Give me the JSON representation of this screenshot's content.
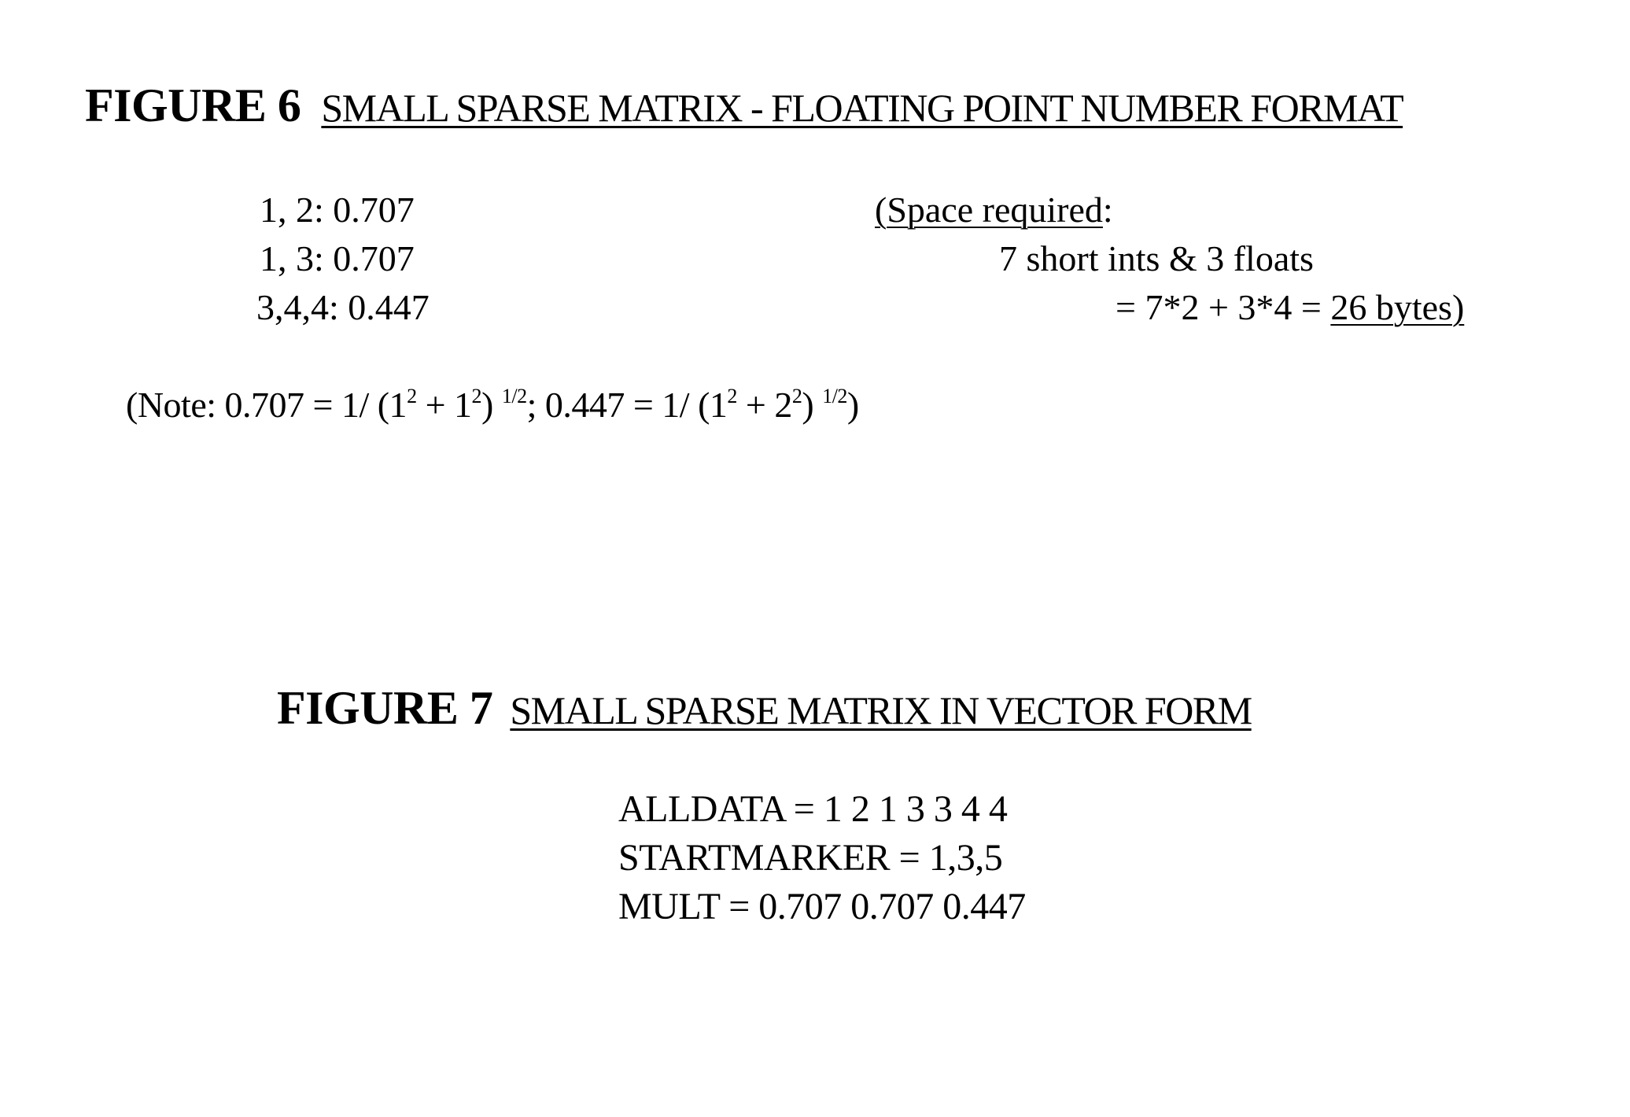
{
  "figure6": {
    "label": "FIGURE 6",
    "title": "SMALL SPARSE MATRIX - FLOATING POINT NUMBER FORMAT",
    "entries": [
      "1, 2: 0.707",
      "1, 3: 0.707",
      "3,4,4: 0.447"
    ],
    "space": {
      "open_paren": "(",
      "heading": "Space required",
      "colon": ":",
      "line2": "7 short ints & 3 floats",
      "line3_prefix": "= 7*2 + 3*4 = ",
      "total": "26 bytes",
      "close_paren": ")"
    },
    "note": {
      "prefix": "(Note:  0.707 = 1/ (1",
      "exp_a1": "2",
      "mid_a": " + 1",
      "exp_a2": "2",
      "close_a": ") ",
      "pow_a": "1/2",
      "sep": ";  0.447 = 1/ (1",
      "exp_b1": "2",
      "mid_b": " + 2",
      "exp_b2": "2",
      "close_b": ") ",
      "pow_b": "1/2",
      "suffix": ")"
    }
  },
  "figure7": {
    "label": "FIGURE 7",
    "title": "SMALL SPARSE MATRIX IN VECTOR FORM",
    "lines": [
      "ALLDATA = 1 2 1 3 3 4 4",
      "STARTMARKER = 1,3,5",
      "MULT = 0.707 0.707 0.447"
    ]
  }
}
